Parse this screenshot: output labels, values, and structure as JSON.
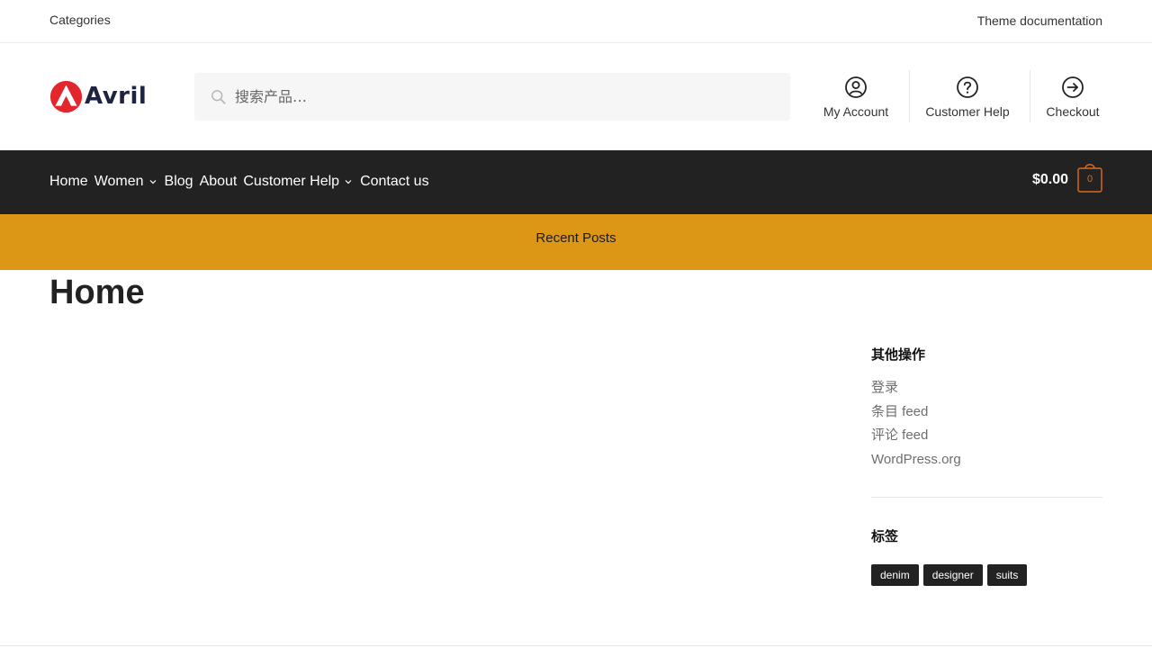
{
  "topbar": {
    "left_link": "Categories",
    "right_link": "Theme documentation"
  },
  "logo": {
    "text": "Avril",
    "brand_color": "#e3262c",
    "text_color": "#1d2340"
  },
  "search": {
    "placeholder": "搜索产品…",
    "icon": "search-icon"
  },
  "header_links": [
    {
      "label": "My Account",
      "icon": "user-circle-icon"
    },
    {
      "label": "Customer Help",
      "icon": "help-circle-icon"
    },
    {
      "label": "Checkout",
      "icon": "arrow-right-circle-icon"
    }
  ],
  "nav": {
    "items": [
      {
        "label": "Home"
      },
      {
        "label": "Women"
      },
      {
        "label": "Blog"
      },
      {
        "label": "About"
      },
      {
        "label": "Customer Help"
      },
      {
        "label": "Contact us"
      }
    ],
    "background": "#222222"
  },
  "cart": {
    "amount": "$0.00",
    "count": "0",
    "accent": "#dd6b20"
  },
  "banner": {
    "text": "Recent Posts",
    "background": "#dd9716"
  },
  "page": {
    "title": "Home"
  },
  "sidebar": {
    "meta_title": "其他操作",
    "meta_links": [
      "登录",
      "条目 feed",
      "评论 feed",
      "WordPress.org"
    ],
    "tags_title": "标签",
    "tags": [
      "denim",
      "designer",
      "suits"
    ]
  }
}
